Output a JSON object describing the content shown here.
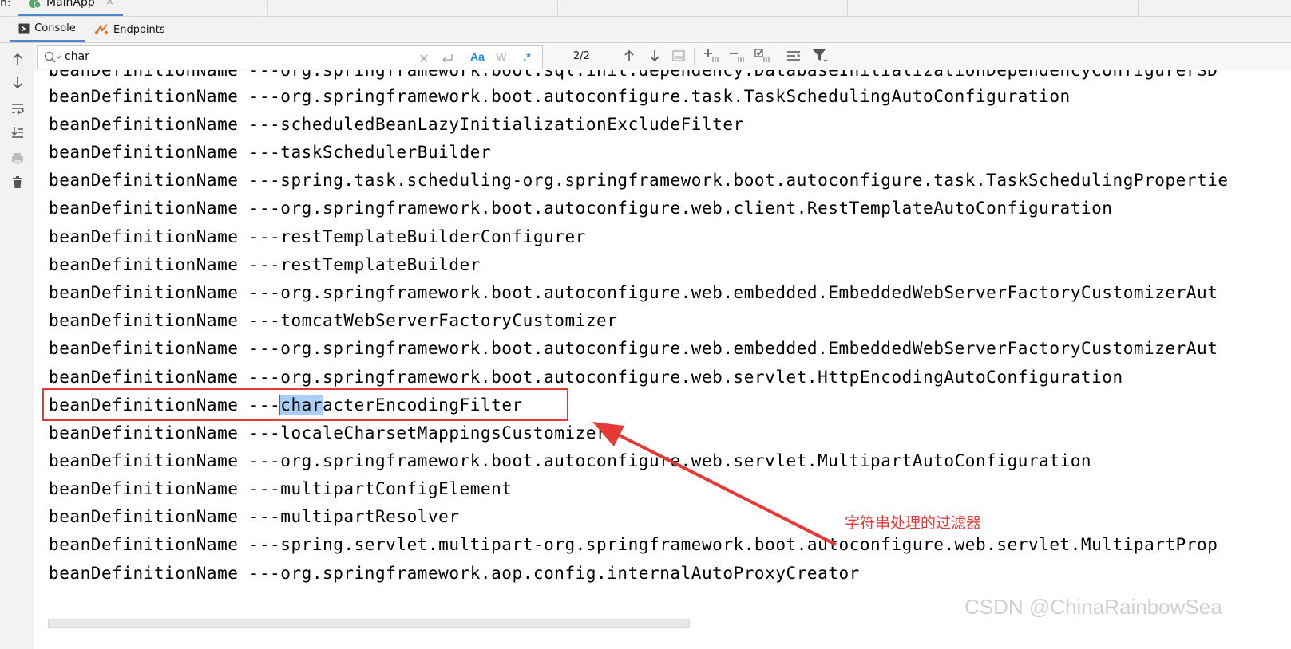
{
  "run_bar": {
    "prefix": "n:",
    "app_tab": "MainApp",
    "close_glyph": "×"
  },
  "tool_tabs": [
    {
      "label": "Console",
      "icon": "console-icon",
      "active": true
    },
    {
      "label": "Endpoints",
      "icon": "endpoints-icon",
      "active": false
    }
  ],
  "search": {
    "value": "char",
    "match_count": "2/2",
    "match_case_label": "Aa",
    "words_label": "W",
    "regex_label": ".*"
  },
  "colors": {
    "accent": "#4a86c8",
    "highlight": "#a9cdf5",
    "annotation": "#e53935",
    "regex_active": "#1a8fd6"
  },
  "console_lines": [
    "beanDefinitionName ---org.springframework.boot.sql.init.dependency.DatabaseInitializationDependencyConfigurer$D",
    "beanDefinitionName ---org.springframework.boot.autoconfigure.task.TaskSchedulingAutoConfiguration",
    "beanDefinitionName ---scheduledBeanLazyInitializationExcludeFilter",
    "beanDefinitionName ---taskSchedulerBuilder",
    "beanDefinitionName ---spring.task.scheduling-org.springframework.boot.autoconfigure.task.TaskSchedulingPropertie",
    "beanDefinitionName ---org.springframework.boot.autoconfigure.web.client.RestTemplateAutoConfiguration",
    "beanDefinitionName ---restTemplateBuilderConfigurer",
    "beanDefinitionName ---restTemplateBuilder",
    "beanDefinitionName ---org.springframework.boot.autoconfigure.web.embedded.EmbeddedWebServerFactoryCustomizerAut",
    "beanDefinitionName ---tomcatWebServerFactoryCustomizer",
    "beanDefinitionName ---org.springframework.boot.autoconfigure.web.embedded.EmbeddedWebServerFactoryCustomizerAut",
    "beanDefinitionName ---org.springframework.boot.autoconfigure.web.servlet.HttpEncodingAutoConfiguration",
    "beanDefinitionName ---characterEncodingFilter",
    "beanDefinitionName ---localeCharsetMappingsCustomizer",
    "beanDefinitionName ---org.springframework.boot.autoconfigure.web.servlet.MultipartAutoConfiguration",
    "beanDefinitionName ---multipartConfigElement",
    "beanDefinitionName ---multipartResolver",
    "beanDefinitionName ---spring.servlet.multipart-org.springframework.boot.autoconfigure.web.servlet.MultipartProp",
    "beanDefinitionName ---org.springframework.aop.config.internalAutoProxyCreator"
  ],
  "highlighted_line": {
    "prefix": "beanDefinitionName ---",
    "match": "char",
    "rest": "acterEncodingFilter"
  },
  "annotation": "字符串处理的过滤器",
  "watermark": "CSDN @ChinaRainbowSea"
}
